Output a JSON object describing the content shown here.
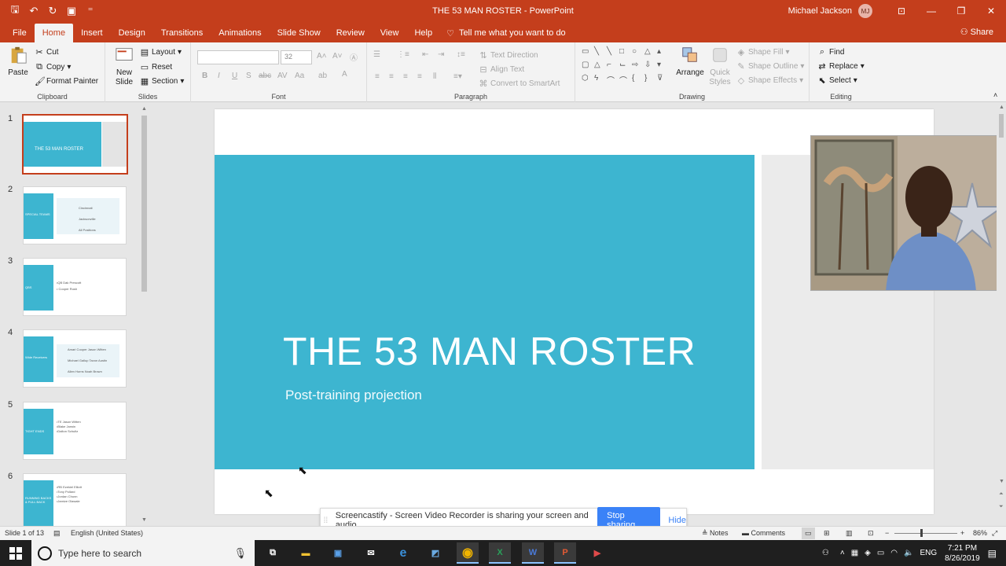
{
  "window": {
    "title": "THE 53 MAN ROSTER  -  PowerPoint",
    "user_name": "Michael Jackson",
    "user_initials": "MJ"
  },
  "ribbon_tabs": [
    "File",
    "Home",
    "Insert",
    "Design",
    "Transitions",
    "Animations",
    "Slide Show",
    "Review",
    "View",
    "Help"
  ],
  "tell_me": "Tell me what you want to do",
  "share_label": "Share",
  "ribbon": {
    "clipboard": {
      "paste": "Paste",
      "cut": "Cut",
      "copy": "Copy",
      "format_painter": "Format Painter",
      "label": "Clipboard"
    },
    "slides": {
      "new_slide": "New Slide",
      "layout": "Layout",
      "reset": "Reset",
      "section": "Section",
      "label": "Slides"
    },
    "font": {
      "font_name": "",
      "font_size": "32",
      "label": "Font"
    },
    "paragraph": {
      "text_direction": "Text Direction",
      "align_text": "Align Text",
      "convert_smartart": "Convert to SmartArt",
      "label": "Paragraph"
    },
    "drawing": {
      "arrange": "Arrange",
      "quick_styles": "Quick Styles",
      "shape_fill": "Shape Fill",
      "shape_outline": "Shape Outline",
      "shape_effects": "Shape Effects",
      "label": "Drawing"
    },
    "editing": {
      "find": "Find",
      "replace": "Replace",
      "select": "Select",
      "label": "Editing"
    }
  },
  "thumbnails": [
    {
      "num": "1",
      "band": "THE 53 MAN ROSTER",
      "lines": []
    },
    {
      "num": "2",
      "band": "SPECIAL TEAMS",
      "lines": [
        "Cincinnati",
        "Jacksonville",
        "All Positions"
      ]
    },
    {
      "num": "3",
      "band": "QBS",
      "lines": [
        "•QB Dak Prescott",
        "• Cooper Rush"
      ]
    },
    {
      "num": "4",
      "band": "Wide Receivers",
      "lines": [
        "Amari Cooper  Jason Witten",
        "Michael Gallup  Tavon Austin",
        "Allen Hurns  Noah Brown"
      ]
    },
    {
      "num": "5",
      "band": "TIGHT ENDS",
      "lines": [
        "•TE Jason Witten",
        "•Blake Jarwin",
        "•Dalton Schultz"
      ]
    },
    {
      "num": "6",
      "band": "RUNNING BACKS & FULL BACK",
      "lines": [
        "•RB Ezekiel Elliott",
        "•Tony Pollard",
        "•Jordan Chunn",
        "•Jamize Olawale"
      ]
    }
  ],
  "slide": {
    "title": "THE 53 MAN ROSTER",
    "subtitle": "Post-training projection",
    "band_color": "#3db5d0"
  },
  "screencastify": {
    "message": "Screencastify - Screen Video Recorder is sharing your screen and audio.",
    "stop": "Stop sharing",
    "hide": "Hide"
  },
  "status": {
    "slide_count": "Slide 1 of 13",
    "language": "English (United States)",
    "notes": "Notes",
    "comments": "Comments",
    "zoom": "86%"
  },
  "taskbar": {
    "search_placeholder": "Type here to search",
    "lang": "ENG",
    "time": "7:21 PM",
    "date": "8/26/2019"
  },
  "colors": {
    "accent": "#c43e1c",
    "slide_band": "#3db5d0"
  }
}
